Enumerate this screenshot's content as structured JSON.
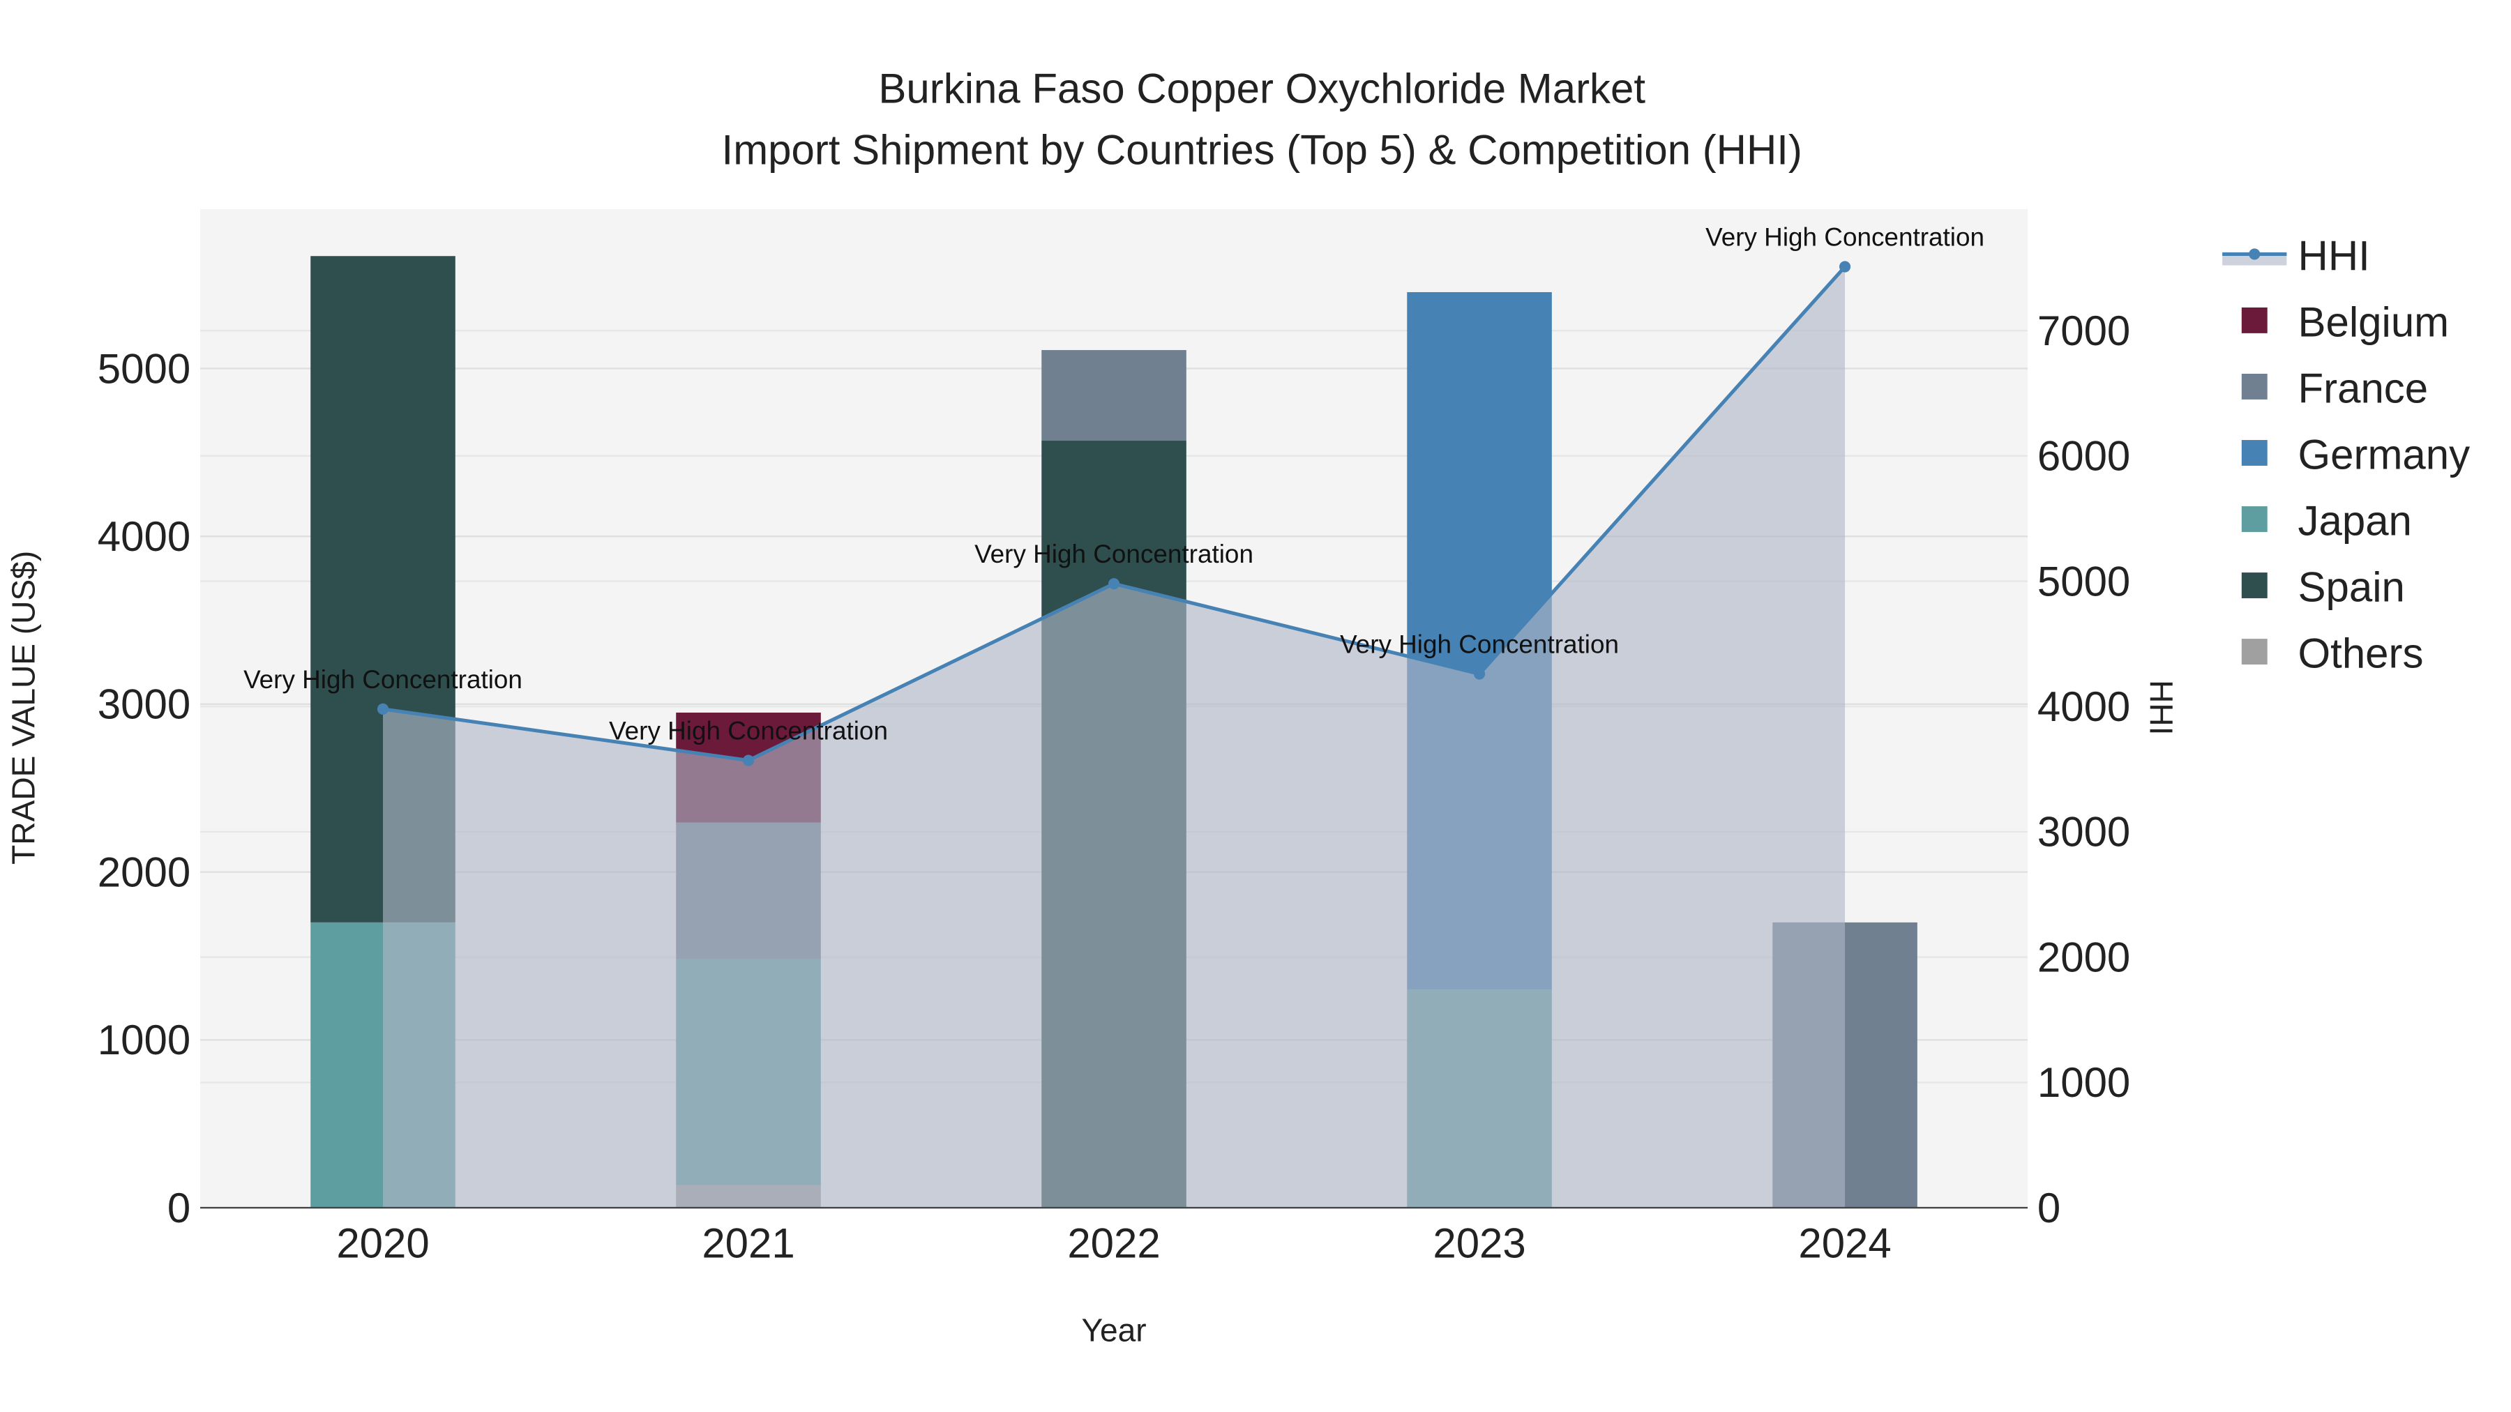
{
  "chart_data": {
    "type": "bar",
    "title_line1": "Burkina Faso Copper Oxychloride Market",
    "title_line2": "Import Shipment by Countries (Top 5) & Competition (HHI)",
    "xlabel": "Year",
    "ylabel": "TRADE VALUE (US$)",
    "y2label": "HHI",
    "categories": [
      "2020",
      "2021",
      "2022",
      "2023",
      "2024"
    ],
    "ylim": [
      0,
      5950
    ],
    "y2lim": [
      0,
      7970
    ],
    "yticks": [
      0,
      1000,
      2000,
      3000,
      4000,
      5000
    ],
    "y2ticks": [
      0,
      1000,
      2000,
      3000,
      4000,
      5000,
      6000,
      7000
    ],
    "stack_order": [
      "Others",
      "Japan",
      "Spain",
      "France",
      "Germany",
      "Belgium"
    ],
    "series": [
      {
        "name": "Belgium",
        "color": "#6b1a3a",
        "values": [
          0,
          655,
          0,
          0,
          0
        ]
      },
      {
        "name": "France",
        "color": "#708090",
        "values": [
          0,
          815,
          540,
          0,
          1700
        ]
      },
      {
        "name": "Germany",
        "color": "#4682b4",
        "values": [
          0,
          0,
          0,
          4155,
          0
        ]
      },
      {
        "name": "Japan",
        "color": "#5f9ea0",
        "values": [
          1700,
          1345,
          0,
          1300,
          0
        ]
      },
      {
        "name": "Spain",
        "color": "#2f4f4f",
        "values": [
          3970,
          0,
          4570,
          0,
          0
        ]
      },
      {
        "name": "Others",
        "color": "#a0a0a0",
        "values": [
          0,
          135,
          0,
          0,
          0
        ]
      }
    ],
    "hhi": {
      "name": "HHI",
      "color": "#4682b4",
      "values": [
        3980,
        3570,
        4980,
        4260,
        7510
      ],
      "annotations": [
        "Very High Concentration",
        "Very High Concentration",
        "Very High Concentration",
        "Very High Concentration",
        "Very High Concentration"
      ]
    },
    "legend_entries": [
      "HHI",
      "Belgium",
      "France",
      "Germany",
      "Japan",
      "Spain",
      "Others"
    ],
    "legend_placement": "right",
    "grid": true
  }
}
